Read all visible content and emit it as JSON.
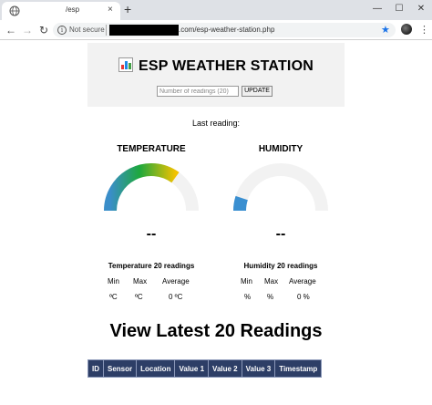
{
  "browser": {
    "tab_title": "/esp",
    "tab_close": "×",
    "new_tab": "+",
    "window_min": "—",
    "window_max": "☐",
    "window_close": "✕",
    "omnibox_security": "Not secure",
    "url_visible": ".com/esp-weather-station.php",
    "icons": {
      "favicon": "globe-icon",
      "back": "back-arrow-icon",
      "forward": "forward-arrow-icon",
      "reload": "reload-icon",
      "info": "info-icon",
      "bookmark": "star-icon",
      "menu": "kebab-menu-icon"
    },
    "bookmark_color": "#1a73e8"
  },
  "header": {
    "title": "ESP WEATHER STATION",
    "readings_placeholder": "Number of readings (20)",
    "update_label": "UPDATE",
    "icon": "bar-chart-icon"
  },
  "last_reading_label": "Last reading:",
  "gauges": {
    "temperature": {
      "title": "TEMPERATURE",
      "value": "--",
      "fill_fraction": 0.7,
      "gradient": [
        "#3a8ec9",
        "#1ea83d",
        "#f2c200"
      ],
      "track_color": "#f2f2f2"
    },
    "humidity": {
      "title": "HUMIDITY",
      "value": "--",
      "fill_fraction": 0.1,
      "fill_color": "#3a8fd1",
      "track_color": "#f2f2f2"
    }
  },
  "stats": {
    "temperature": {
      "title": "Temperature 20 readings",
      "headers": [
        "Min",
        "Max",
        "Average"
      ],
      "values": [
        "ºC",
        "ºC",
        "0 ºC"
      ]
    },
    "humidity": {
      "title": "Humidity 20 readings",
      "headers": [
        "Min",
        "Max",
        "Average"
      ],
      "values": [
        "%",
        "%",
        "0 %"
      ]
    }
  },
  "readings": {
    "title": "View Latest 20 Readings",
    "columns": [
      "ID",
      "Sensor",
      "Location",
      "Value 1",
      "Value 2",
      "Value 3",
      "Timestamp"
    ],
    "header_color": "#2d3e66"
  }
}
